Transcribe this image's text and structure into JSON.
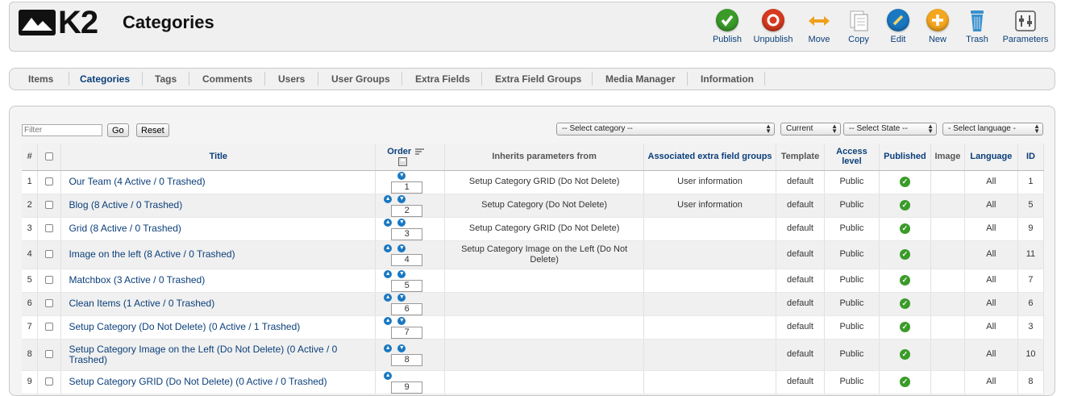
{
  "header": {
    "logo_text": "K2",
    "page_title": "Categories"
  },
  "toolbar": [
    {
      "id": "publish",
      "label": "Publish",
      "icon": "publish-icon",
      "color": "#3a9b29"
    },
    {
      "id": "unpublish",
      "label": "Unpublish",
      "icon": "unpublish-icon",
      "color": "#d73a1f"
    },
    {
      "id": "move",
      "label": "Move",
      "icon": "move-icon",
      "color": "#f0a01c"
    },
    {
      "id": "copy",
      "label": "Copy",
      "icon": "copy-icon",
      "color": "#cfcfcf"
    },
    {
      "id": "edit",
      "label": "Edit",
      "icon": "edit-icon",
      "color": "#1a78c2"
    },
    {
      "id": "new",
      "label": "New",
      "icon": "new-icon",
      "color": "#f5a71f"
    },
    {
      "id": "trash",
      "label": "Trash",
      "icon": "trash-icon",
      "color": "#3a90cc"
    },
    {
      "id": "parameters",
      "label": "Parameters",
      "icon": "parameters-icon",
      "color": "#777777"
    }
  ],
  "tabs": [
    {
      "label": "Items",
      "active": false
    },
    {
      "label": "Categories",
      "active": true
    },
    {
      "label": "Tags",
      "active": false
    },
    {
      "label": "Comments",
      "active": false
    },
    {
      "label": "Users",
      "active": false
    },
    {
      "label": "User Groups",
      "active": false
    },
    {
      "label": "Extra Fields",
      "active": false
    },
    {
      "label": "Extra Field Groups",
      "active": false
    },
    {
      "label": "Media Manager",
      "active": false
    },
    {
      "label": "Information",
      "active": false
    }
  ],
  "filters": {
    "filter_placeholder": "Filter",
    "go_label": "Go",
    "reset_label": "Reset",
    "category_select": "-- Select category --",
    "state_scope_select": "Current",
    "state_select": "-- Select State --",
    "language_select": "- Select language -"
  },
  "table": {
    "headers": {
      "num": "#",
      "title": "Title",
      "order": "Order",
      "inherits": "Inherits parameters from",
      "extra_field_groups": "Associated extra field groups",
      "template": "Template",
      "access": "Access level",
      "published": "Published",
      "image": "Image",
      "language": "Language",
      "id": "ID"
    },
    "rows": [
      {
        "num": "1",
        "title": "Our Team (4 Active / 0 Trashed)",
        "up": false,
        "down": true,
        "order": "1",
        "inherits": "Setup Category GRID (Do Not Delete)",
        "extra": "User information",
        "template": "default",
        "access": "Public",
        "language": "All",
        "id": "1"
      },
      {
        "num": "2",
        "title": "Blog (8 Active / 0 Trashed)",
        "up": true,
        "down": true,
        "order": "2",
        "inherits": "Setup Category (Do Not Delete)",
        "extra": "User information",
        "template": "default",
        "access": "Public",
        "language": "All",
        "id": "5"
      },
      {
        "num": "3",
        "title": "Grid (8 Active / 0 Trashed)",
        "up": true,
        "down": true,
        "order": "3",
        "inherits": "Setup Category GRID (Do Not Delete)",
        "extra": "",
        "template": "default",
        "access": "Public",
        "language": "All",
        "id": "9"
      },
      {
        "num": "4",
        "title": "Image on the left (8 Active / 0 Trashed)",
        "up": true,
        "down": true,
        "order": "4",
        "inherits": "Setup Category Image on the Left (Do Not Delete)",
        "extra": "",
        "template": "default",
        "access": "Public",
        "language": "All",
        "id": "11"
      },
      {
        "num": "5",
        "title": "Matchbox (3 Active / 0 Trashed)",
        "up": true,
        "down": true,
        "order": "5",
        "inherits": "",
        "extra": "",
        "template": "default",
        "access": "Public",
        "language": "All",
        "id": "7"
      },
      {
        "num": "6",
        "title": "Clean Items (1 Active / 0 Trashed)",
        "up": true,
        "down": true,
        "order": "6",
        "inherits": "",
        "extra": "",
        "template": "default",
        "access": "Public",
        "language": "All",
        "id": "6"
      },
      {
        "num": "7",
        "title": "Setup Category (Do Not Delete) (0 Active / 1 Trashed)",
        "up": true,
        "down": true,
        "order": "7",
        "inherits": "",
        "extra": "",
        "template": "default",
        "access": "Public",
        "language": "All",
        "id": "3"
      },
      {
        "num": "8",
        "title": "Setup Category Image on the Left (Do Not Delete) (0 Active / 0 Trashed)",
        "up": true,
        "down": true,
        "order": "8",
        "inherits": "",
        "extra": "",
        "template": "default",
        "access": "Public",
        "language": "All",
        "id": "10"
      },
      {
        "num": "9",
        "title": "Setup Category GRID (Do Not Delete) (0 Active / 0 Trashed)",
        "up": true,
        "down": false,
        "order": "9",
        "inherits": "",
        "extra": "",
        "template": "default",
        "access": "Public",
        "language": "All",
        "id": "8"
      }
    ]
  }
}
